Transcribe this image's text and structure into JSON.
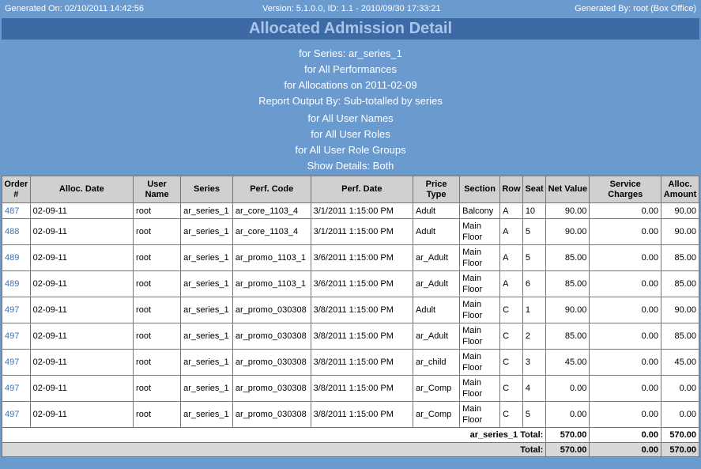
{
  "header": {
    "generated_on": "Generated On: 02/10/2011 14:42:56",
    "version": "Version: 5.1.0.0, ID: 1.1 - 2010/09/30 17:33:21",
    "generated_by": "Generated By: root (Box Office)"
  },
  "title": "Allocated Admission Detail",
  "params": [
    "for Series: ar_series_1",
    "for All Performances",
    "for Allocations on 2011-02-09",
    "Report Output By: Sub-totalled by series",
    "for All User Names",
    "for All User Roles",
    "for All User Role Groups",
    "Show Details: Both"
  ],
  "table": {
    "columns": [
      "Order #",
      "Alloc. Date",
      "User Name",
      "Series",
      "Perf. Code",
      "Perf. Date",
      "Price Type",
      "Section",
      "Row",
      "Seat",
      "Net Value",
      "Service Charges",
      "Alloc. Amount"
    ],
    "rows": [
      [
        "487",
        "02-09-11",
        "root",
        "ar_series_1",
        "ar_core_1103_4",
        "3/1/2011 1:15:00 PM",
        "Adult",
        "Balcony",
        "A",
        "10",
        "90.00",
        "0.00",
        "90.00"
      ],
      [
        "488",
        "02-09-11",
        "root",
        "ar_series_1",
        "ar_core_1103_4",
        "3/1/2011 1:15:00 PM",
        "Adult",
        "Main Floor",
        "A",
        "5",
        "90.00",
        "0.00",
        "90.00"
      ],
      [
        "489",
        "02-09-11",
        "root",
        "ar_series_1",
        "ar_promo_1103_1",
        "3/6/2011 1:15:00 PM",
        "ar_Adult",
        "Main Floor",
        "A",
        "5",
        "85.00",
        "0.00",
        "85.00"
      ],
      [
        "489",
        "02-09-11",
        "root",
        "ar_series_1",
        "ar_promo_1103_1",
        "3/6/2011 1:15:00 PM",
        "ar_Adult",
        "Main Floor",
        "A",
        "6",
        "85.00",
        "0.00",
        "85.00"
      ],
      [
        "497",
        "02-09-11",
        "root",
        "ar_series_1",
        "ar_promo_030308",
        "3/8/2011 1:15:00 PM",
        "Adult",
        "Main Floor",
        "C",
        "1",
        "90.00",
        "0.00",
        "90.00"
      ],
      [
        "497",
        "02-09-11",
        "root",
        "ar_series_1",
        "ar_promo_030308",
        "3/8/2011 1:15:00 PM",
        "ar_Adult",
        "Main Floor",
        "C",
        "2",
        "85.00",
        "0.00",
        "85.00"
      ],
      [
        "497",
        "02-09-11",
        "root",
        "ar_series_1",
        "ar_promo_030308",
        "3/8/2011 1:15:00 PM",
        "ar_child",
        "Main Floor",
        "C",
        "3",
        "45.00",
        "0.00",
        "45.00"
      ],
      [
        "497",
        "02-09-11",
        "root",
        "ar_series_1",
        "ar_promo_030308",
        "3/8/2011 1:15:00 PM",
        "ar_Comp",
        "Main Floor",
        "C",
        "4",
        "0.00",
        "0.00",
        "0.00"
      ],
      [
        "497",
        "02-09-11",
        "root",
        "ar_series_1",
        "ar_promo_030308",
        "3/8/2011 1:15:00 PM",
        "ar_Comp",
        "Main Floor",
        "C",
        "5",
        "0.00",
        "0.00",
        "0.00"
      ]
    ],
    "subtotal": {
      "label": "ar_series_1 Total:",
      "net": "570.00",
      "service": "0.00",
      "amount": "570.00"
    },
    "total": {
      "label": "Total:",
      "net": "570.00",
      "service": "0.00",
      "amount": "570.00"
    }
  }
}
